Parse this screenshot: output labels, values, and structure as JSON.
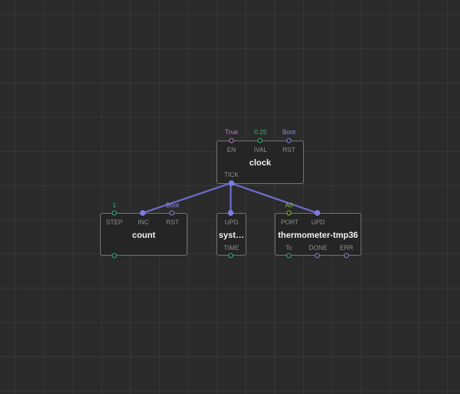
{
  "colors": {
    "background": "#2b2b2b",
    "link": "#6e6bc9",
    "boolean_value": "#c27ac9",
    "number_value": "#2fb67b",
    "pulse_value": "#8d8ae0",
    "port_value": "#8fc23a"
  },
  "nodes": {
    "clock": {
      "title": "clock",
      "inputs": [
        {
          "label": "EN",
          "value": "True"
        },
        {
          "label": "IVAL",
          "value": "0.25"
        },
        {
          "label": "RST",
          "value": "Boot"
        }
      ],
      "outputs": [
        {
          "label": "TICK"
        }
      ]
    },
    "count": {
      "title": "count",
      "inputs": [
        {
          "label": "STEP",
          "value": "1"
        },
        {
          "label": "INC"
        },
        {
          "label": "RST",
          "value": "Boot"
        }
      ]
    },
    "system_time": {
      "title": "syst…",
      "inputs": [
        {
          "label": "UPD"
        }
      ],
      "outputs": [
        {
          "label": "TIME"
        }
      ]
    },
    "thermometer": {
      "title": "thermometer-tmp36",
      "inputs": [
        {
          "label": "PORT",
          "value": "A0"
        },
        {
          "label": "UPD"
        }
      ],
      "outputs": [
        {
          "label": "Tc"
        },
        {
          "label": "DONE"
        },
        {
          "label": "ERR"
        }
      ]
    }
  }
}
